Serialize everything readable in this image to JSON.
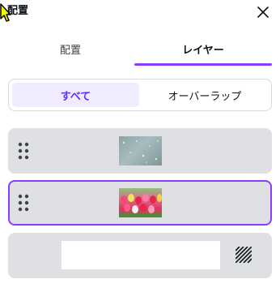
{
  "panel": {
    "title": "配置"
  },
  "tabs": [
    {
      "label": "配置",
      "active": false
    },
    {
      "label": "レイヤー",
      "active": true
    }
  ],
  "filter": {
    "options": [
      {
        "label": "すべて",
        "selected": true
      },
      {
        "label": "オーバーラップ",
        "selected": false
      }
    ]
  },
  "layers": [
    {
      "thumbnail": "rain-on-glass-photo",
      "selected": false,
      "handle_visible": true
    },
    {
      "thumbnail": "tulip-field-photo",
      "selected": true,
      "handle_visible": true
    },
    {
      "thumbnail": "white-rectangle",
      "selected": false,
      "handle_visible": false,
      "trailing_icon": "transparency-pattern-icon"
    }
  ],
  "colors": {
    "accent": "#8b3dff",
    "selected_segment_bg": "#f1ebff",
    "selected_segment_text": "#5a32fa",
    "row_bg": "#dfe0e3"
  }
}
